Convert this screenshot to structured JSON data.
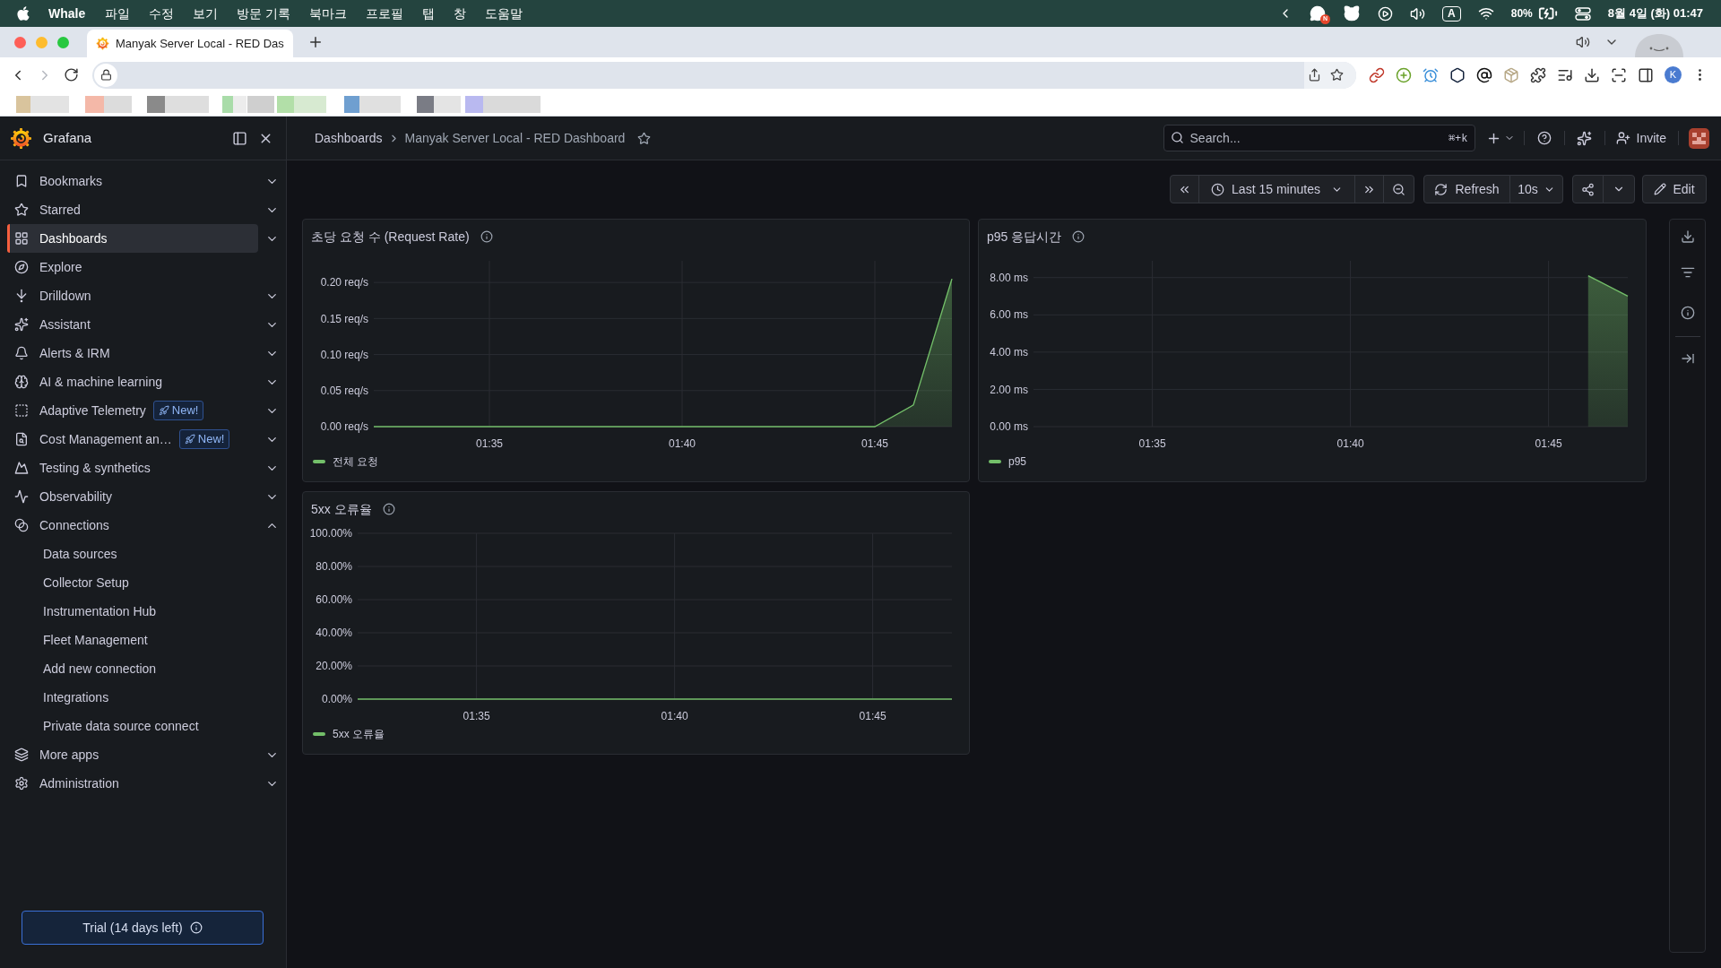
{
  "menubar": {
    "app": "Whale",
    "menus": [
      "파일",
      "수정",
      "보기",
      "방문 기록",
      "북마크",
      "프로필",
      "탭",
      "창",
      "도움말"
    ],
    "notification_badge": "N",
    "input_source": "A",
    "battery": "80%",
    "clock": "8월 4일 (화) 01:47"
  },
  "browser": {
    "tabs": [
      {
        "title": "Manyak Server Local - RED Das",
        "selected": true
      }
    ],
    "profile": "K"
  },
  "sidebar": {
    "brand": "Grafana",
    "items": [
      {
        "label": "Bookmarks",
        "kind": "group",
        "expanded": false,
        "selected": false
      },
      {
        "label": "Starred",
        "kind": "group",
        "expanded": false,
        "selected": false
      },
      {
        "label": "Dashboards",
        "kind": "group",
        "expanded": false,
        "selected": true
      },
      {
        "label": "Explore",
        "kind": "link",
        "selected": false
      },
      {
        "label": "Drilldown",
        "kind": "group",
        "expanded": false,
        "selected": false
      },
      {
        "label": "Assistant",
        "kind": "group",
        "expanded": false,
        "selected": false
      },
      {
        "label": "Alerts & IRM",
        "kind": "group",
        "expanded": false,
        "selected": false
      },
      {
        "label": "AI & machine learning",
        "kind": "group",
        "expanded": false,
        "selected": false
      },
      {
        "label": "Adaptive Telemetry",
        "kind": "group",
        "expanded": false,
        "selected": false,
        "badge": "New!"
      },
      {
        "label": "Cost Management an…",
        "kind": "group",
        "expanded": false,
        "selected": false,
        "badge": "New!"
      },
      {
        "label": "Testing & synthetics",
        "kind": "group",
        "expanded": false,
        "selected": false
      },
      {
        "label": "Observability",
        "kind": "group",
        "expanded": false,
        "selected": false
      },
      {
        "label": "Connections",
        "kind": "group",
        "expanded": true,
        "selected": false,
        "children": [
          {
            "label": "Data sources",
            "selected": false
          },
          {
            "label": "Collector Setup",
            "selected": false
          },
          {
            "label": "Instrumentation Hub",
            "selected": false
          },
          {
            "label": "Fleet Management",
            "selected": false
          },
          {
            "label": "Add new connection",
            "selected": false
          },
          {
            "label": "Integrations",
            "selected": false
          },
          {
            "label": "Private data source connect",
            "selected": false
          }
        ]
      },
      {
        "label": "More apps",
        "kind": "group",
        "expanded": false,
        "selected": false
      },
      {
        "label": "Administration",
        "kind": "group",
        "expanded": false,
        "selected": false
      }
    ],
    "trial": "Trial (14 days left)"
  },
  "header": {
    "breadcrumb": [
      "Dashboards",
      "Manyak Server Local - RED Dashboard"
    ],
    "starred": false,
    "search": {
      "placeholder": "Search...",
      "shortcut": "⌘+k"
    },
    "invite": "Invite"
  },
  "toolbar": {
    "time_range": "Last 15 minutes",
    "refresh": "Refresh",
    "interval": "10s",
    "edit": "Edit"
  },
  "panels": [
    {
      "title": "초당 요청 수 (Request Rate)",
      "chart_data": {
        "type": "area",
        "grid": true,
        "categories": [
          null,
          null,
          null,
          "01:35",
          null,
          null,
          null,
          null,
          "01:40",
          null,
          null,
          null,
          null,
          "01:45",
          null,
          null
        ],
        "ylim": [
          0,
          0.23
        ],
        "yticks": [
          {
            "value": 0,
            "label": "0.00 req/s"
          },
          {
            "value": 0.05,
            "label": "0.05 req/s"
          },
          {
            "value": 0.1,
            "label": "0.10 req/s"
          },
          {
            "value": 0.15,
            "label": "0.15 req/s"
          },
          {
            "value": 0.2,
            "label": "0.20 req/s"
          }
        ],
        "series": [
          {
            "name": "전체 요청",
            "color": "#73bf69",
            "values": [
              0,
              0,
              0,
              0,
              0,
              0,
              0,
              0,
              0,
              0,
              0,
              0,
              0,
              0,
              0.03,
              0.205
            ]
          }
        ]
      }
    },
    {
      "title": "p95 응답시간",
      "chart_data": {
        "type": "area",
        "grid": true,
        "categories": [
          null,
          null,
          null,
          "01:35",
          null,
          null,
          null,
          null,
          "01:40",
          null,
          null,
          null,
          null,
          "01:45",
          null,
          null
        ],
        "ylim": [
          0,
          8.9
        ],
        "yticks": [
          {
            "value": 0,
            "label": "0.00 ms"
          },
          {
            "value": 2,
            "label": "2.00 ms"
          },
          {
            "value": 4,
            "label": "4.00 ms"
          },
          {
            "value": 6,
            "label": "6.00 ms"
          },
          {
            "value": 8,
            "label": "8.00 ms"
          }
        ],
        "series": [
          {
            "name": "p95",
            "color": "#73bf69",
            "values": [
              null,
              null,
              null,
              null,
              null,
              null,
              null,
              null,
              null,
              null,
              null,
              null,
              null,
              null,
              8.1,
              7.0
            ]
          }
        ]
      }
    },
    {
      "title": "5xx 오류율",
      "chart_data": {
        "type": "line",
        "grid": true,
        "categories": [
          null,
          null,
          null,
          "01:35",
          null,
          null,
          null,
          null,
          "01:40",
          null,
          null,
          null,
          null,
          "01:45",
          null,
          null
        ],
        "ylim": [
          0,
          100
        ],
        "yticks": [
          {
            "value": 0,
            "label": "0.00%"
          },
          {
            "value": 20,
            "label": "20.00%"
          },
          {
            "value": 40,
            "label": "40.00%"
          },
          {
            "value": 60,
            "label": "60.00%"
          },
          {
            "value": 80,
            "label": "80.00%"
          },
          {
            "value": 100,
            "label": "100.00%"
          }
        ],
        "series": [
          {
            "name": "5xx 오류율",
            "color": "#73bf69",
            "values": [
              0,
              0,
              0,
              0,
              0,
              0,
              0,
              0,
              0,
              0,
              0,
              0,
              0,
              0,
              0,
              0
            ]
          }
        ]
      }
    }
  ]
}
